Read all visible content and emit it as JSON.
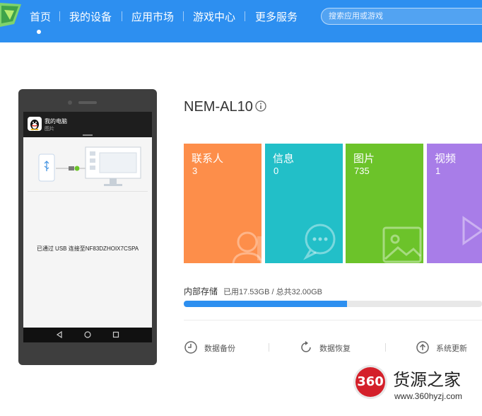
{
  "nav": {
    "items": [
      "首页",
      "我的设备",
      "应用市场",
      "游戏中心",
      "更多服务"
    ],
    "search_placeholder": "搜索应用或游戏"
  },
  "phone": {
    "notification": {
      "title": "我的电脑",
      "subtitle": "图片"
    },
    "usb_status": "已通过 USB 连接至NF83DZHOIX7CSPA"
  },
  "device": {
    "name": "NEM-AL10"
  },
  "tiles": [
    {
      "label": "联系人",
      "count": "3",
      "color": "#fd8e4a"
    },
    {
      "label": "信息",
      "count": "0",
      "color": "#22bfc8"
    },
    {
      "label": "图片",
      "count": "735",
      "color": "#6cc32a"
    },
    {
      "label": "视频",
      "count": "1",
      "color": "#a87de8"
    }
  ],
  "storage": {
    "label": "内部存储",
    "detail": "已用17.53GB / 总共32.00GB",
    "used_fraction": 0.548
  },
  "actions": [
    {
      "label": "数据备份",
      "icon": "clock-icon"
    },
    {
      "label": "数据恢复",
      "icon": "restore-icon"
    },
    {
      "label": "系统更新",
      "icon": "upgrade-arrow-icon"
    }
  ],
  "watermark": {
    "badge": "360",
    "title": "货源之家",
    "url": "www.360hyzj.com"
  },
  "colors": {
    "topbar": "#2d8ff0",
    "progress": "#2d8ff0"
  }
}
